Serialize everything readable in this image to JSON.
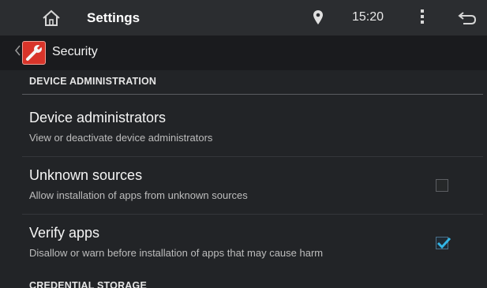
{
  "statusbar": {
    "title": "Settings",
    "time": "15:20",
    "icons": [
      "home-icon",
      "location-pin-icon",
      "overflow-menu-icon",
      "back-icon"
    ]
  },
  "actionbar": {
    "title": "Security",
    "icons": [
      "up-chevron-icon",
      "security-app-icon"
    ]
  },
  "sections": [
    {
      "header": "DEVICE ADMINISTRATION",
      "items": [
        {
          "title": "Device administrators",
          "subtitle": "View or deactivate device administrators",
          "has_checkbox": false
        },
        {
          "title": "Unknown sources",
          "subtitle": "Allow installation of apps from unknown sources",
          "has_checkbox": true,
          "checked": false
        },
        {
          "title": "Verify apps",
          "subtitle": "Disallow or warn before installation of apps that may cause harm",
          "has_checkbox": true,
          "checked": true
        }
      ]
    },
    {
      "header": "CREDENTIAL STORAGE"
    }
  ],
  "colors": {
    "accent": "#33b5e5",
    "background": "#222427",
    "statusbar": "#2b2d30",
    "actionbar": "#1a1b1e"
  }
}
